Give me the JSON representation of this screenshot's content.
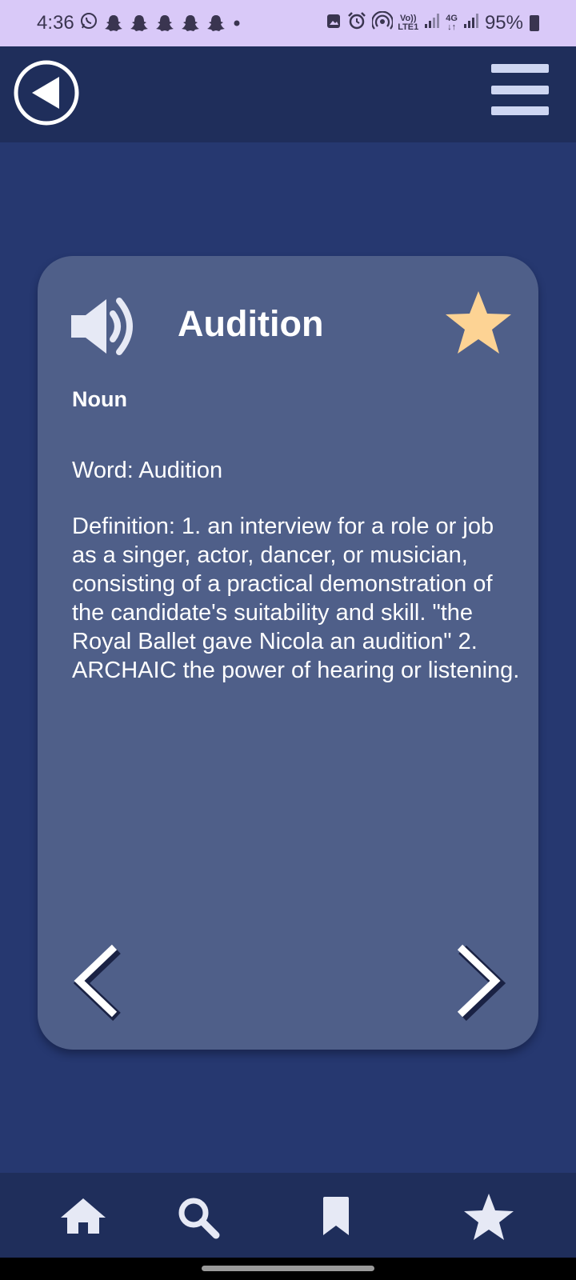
{
  "status_bar": {
    "time": "4:36",
    "network_top": "Vo))",
    "network_bottom": "LTE1",
    "data_type": "4G",
    "battery": "95%"
  },
  "app_bar": {
    "back_icon": "back-arrow-circle-icon",
    "menu_icon": "hamburger-menu-icon"
  },
  "card": {
    "word": "Audition",
    "part_of_speech": "Noun",
    "word_line": "Word: Audition",
    "definition": "Definition: 1. an interview for a role or job as a singer, actor, dancer, or musician, consisting of a practical demonstration of the candidate's suitability and skill. \"the Royal Ballet gave Nicola an audition\" 2. ARCHAIC the power of hearing or listening.",
    "favorite_color": "#fdd394",
    "speaker_icon": "speaker-icon",
    "prev_icon": "chevron-left-icon",
    "next_icon": "chevron-right-icon"
  },
  "bottom_nav": {
    "items": [
      "home-icon",
      "search-icon",
      "bookmark-icon",
      "star-icon"
    ]
  },
  "colors": {
    "background": "#263870",
    "bar": "#1f2e5b",
    "card": "#4f5f89",
    "status_bar": "#d9c9f8"
  }
}
